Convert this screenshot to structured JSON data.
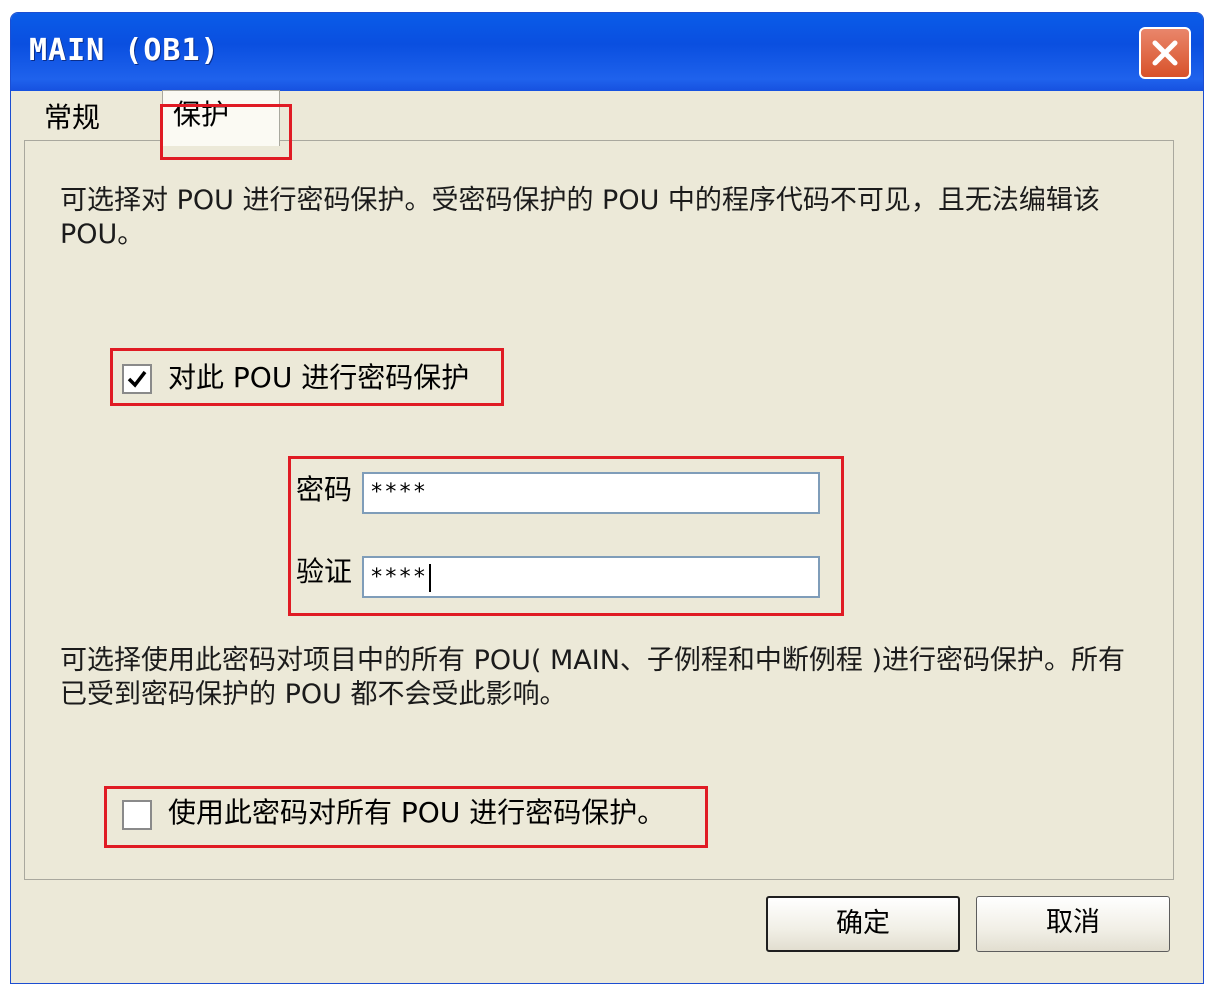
{
  "window": {
    "title": "MAIN (OB1)",
    "close_icon": "close-icon"
  },
  "tabs": [
    {
      "label": "常规",
      "active": false
    },
    {
      "label": "保护",
      "active": true
    }
  ],
  "protection": {
    "description": "可选择对 POU 进行密码保护。受密码保护的 POU 中的程序代码不可见，且无法编辑该 POU。",
    "protect_checkbox": {
      "label": "对此 POU 进行密码保护",
      "checked": true
    },
    "password": {
      "label": "密码",
      "value": "****"
    },
    "verify": {
      "label": "验证",
      "value": "****"
    },
    "all_description": "可选择使用此密码对项目中的所有 POU( MAIN、子例程和中断例程 )进行密码保护。所有已受到密码保护的 POU 都不会受此影响。",
    "all_checkbox": {
      "label": "使用此密码对所有 POU 进行密码保护。",
      "checked": false
    }
  },
  "buttons": {
    "ok": "确定",
    "cancel": "取消"
  },
  "colors": {
    "titlebar": "#0a4fe0",
    "dialog_bg": "#ece9d8",
    "highlight": "#e01b24"
  }
}
